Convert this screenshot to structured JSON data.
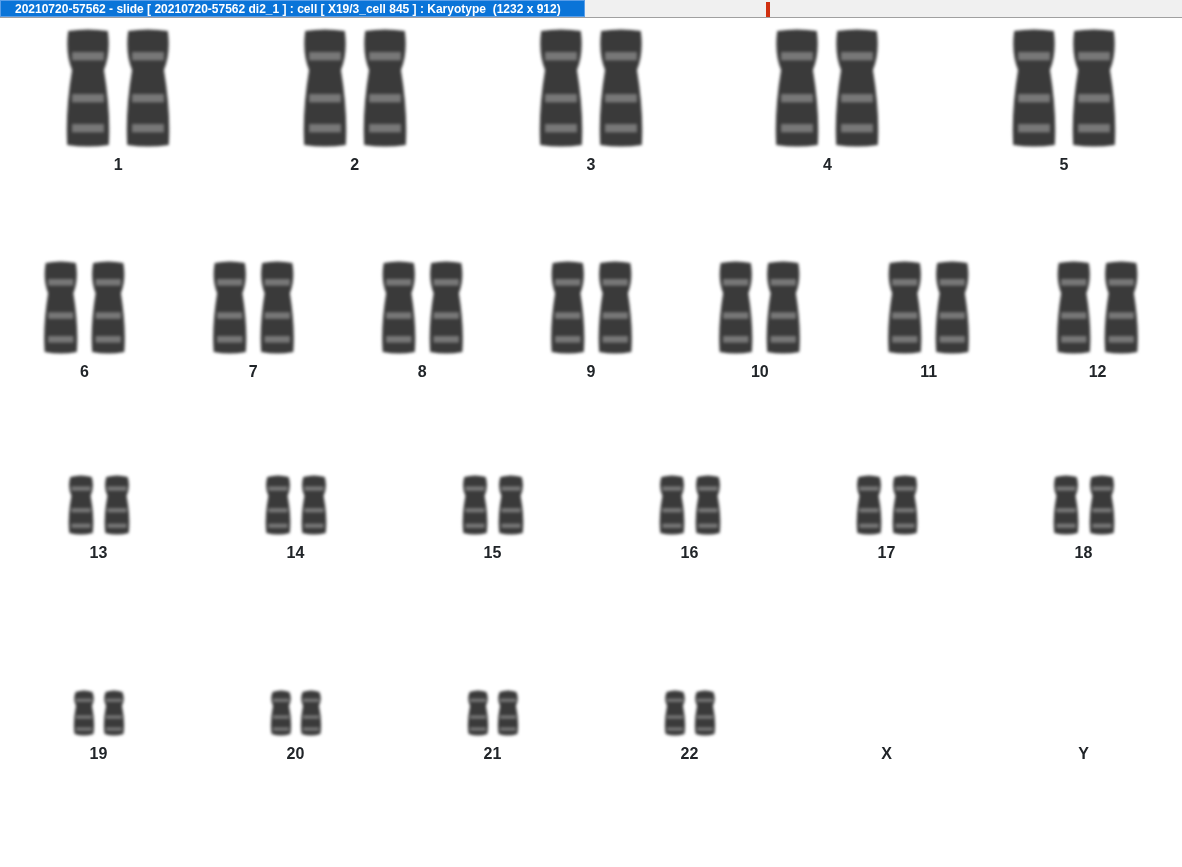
{
  "window": {
    "title": "20210720-57562 - slide [ 20210720-57562 di2_1 ] : cell [ X19/3_cell 845 ] : Karyotype  (1232 x 912)"
  },
  "rows": [
    {
      "pairs": [
        {
          "label": "1",
          "empty": false
        },
        {
          "label": "2",
          "empty": false
        },
        {
          "label": "3",
          "empty": false
        },
        {
          "label": "4",
          "empty": false
        },
        {
          "label": "5",
          "empty": false
        }
      ]
    },
    {
      "pairs": [
        {
          "label": "6",
          "empty": false
        },
        {
          "label": "7",
          "empty": false
        },
        {
          "label": "8",
          "empty": false
        },
        {
          "label": "9",
          "empty": false
        },
        {
          "label": "10",
          "empty": false
        },
        {
          "label": "11",
          "empty": false
        },
        {
          "label": "12",
          "empty": false
        }
      ]
    },
    {
      "pairs": [
        {
          "label": "13",
          "empty": false
        },
        {
          "label": "14",
          "empty": false
        },
        {
          "label": "15",
          "empty": false
        },
        {
          "label": "16",
          "empty": false
        },
        {
          "label": "17",
          "empty": false
        },
        {
          "label": "18",
          "empty": false
        }
      ]
    },
    {
      "pairs": [
        {
          "label": "19",
          "empty": false
        },
        {
          "label": "20",
          "empty": false
        },
        {
          "label": "21",
          "empty": false
        },
        {
          "label": "22",
          "empty": false
        },
        {
          "label": "X",
          "empty": true
        },
        {
          "label": "Y",
          "empty": true
        }
      ]
    }
  ]
}
